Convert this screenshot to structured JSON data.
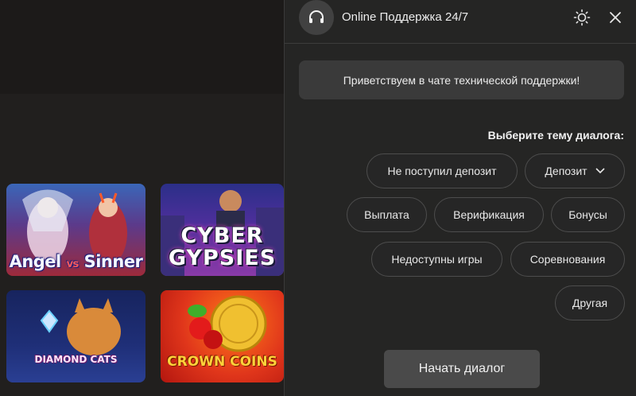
{
  "chat": {
    "title": "Online Поддержка 24/7",
    "greeting": "Приветствуем в чате технической поддержки!",
    "topic_prompt": "Выберите тему диалога:",
    "topics": [
      "Не поступил депозит",
      "Депозит",
      "Выплата",
      "Верификация",
      "Бонусы",
      "Недоступны игры",
      "Соревнования",
      "Другая"
    ],
    "start_button": "Начать диалог",
    "icons": {
      "avatar": "headset-icon",
      "theme": "sun-icon",
      "close": "close-icon",
      "dropdown": "chevron-down-icon"
    }
  },
  "games": [
    {
      "title_part1": "Angel",
      "title_part2": "vs",
      "title_part3": "Sinner"
    },
    {
      "title_line1": "CYBER",
      "title_line2": "GYPSIES"
    },
    {
      "title": "DIAMOND CATS"
    },
    {
      "title": "CROWN COINS"
    }
  ],
  "colors": {
    "panel_bg": "#252524",
    "chip_border": "#4d4d4d",
    "button_bg": "#4a4a4a",
    "text": "#ececec"
  }
}
